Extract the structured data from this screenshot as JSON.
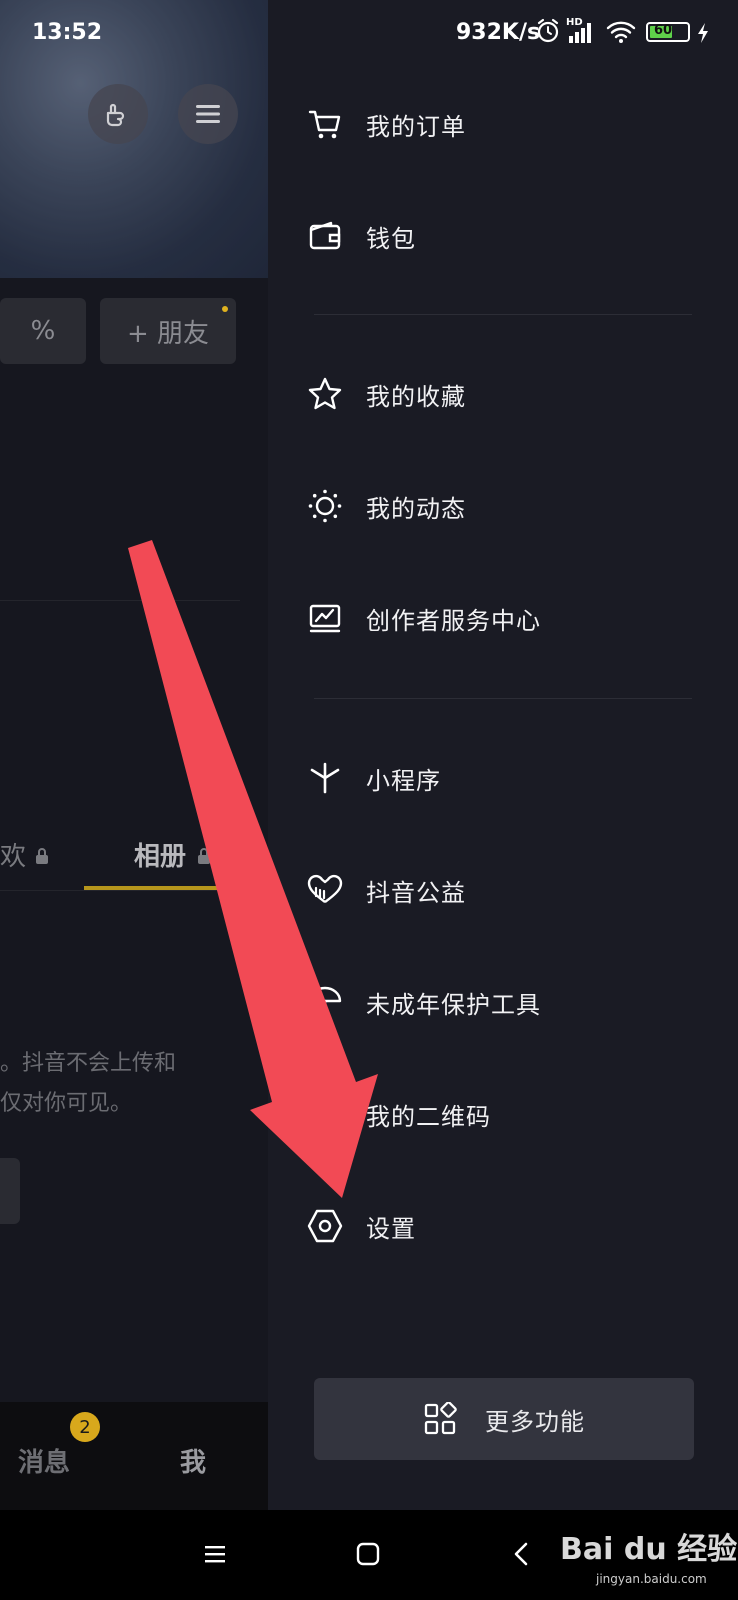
{
  "status_bar": {
    "time": "13:52",
    "net_speed": "932K/s",
    "hd": "HD",
    "battery": "60"
  },
  "left_page": {
    "add_friend_label": "+ 朋友",
    "partial_pill_text": "%",
    "tabs": [
      {
        "label": "欢"
      },
      {
        "label": "相册"
      }
    ],
    "notice_line1": "。抖音不会上传和",
    "notice_line2": "仅对你可见。",
    "bottom_tabs": [
      {
        "label": "消息",
        "badge": "2"
      },
      {
        "label": "我"
      }
    ]
  },
  "drawer": {
    "items": [
      {
        "label": "我的订单",
        "icon": "cart-icon"
      },
      {
        "label": "钱包",
        "icon": "wallet-icon"
      },
      {
        "label": "我的收藏",
        "icon": "star-icon"
      },
      {
        "label": "我的动态",
        "icon": "sun-icon"
      },
      {
        "label": "创作者服务中心",
        "icon": "monitor-chart-icon"
      },
      {
        "label": "小程序",
        "icon": "asterisk-icon"
      },
      {
        "label": "抖音公益",
        "icon": "heart-hand-icon"
      },
      {
        "label": "未成年保护工具",
        "icon": "umbrella-icon"
      },
      {
        "label": "我的二维码",
        "icon": "qr-icon"
      },
      {
        "label": "设置",
        "icon": "hexagon-gear-icon"
      }
    ],
    "more_button": {
      "label": "更多功能",
      "icon": "grid-icon"
    }
  },
  "watermark": {
    "text": "Bai du 经验",
    "url_text": "jingyan.baidu.com"
  },
  "colors": {
    "drawer_bg": "#1a1b24",
    "accent_yellow": "#e0b21f",
    "arrow_red": "#f24a55"
  }
}
